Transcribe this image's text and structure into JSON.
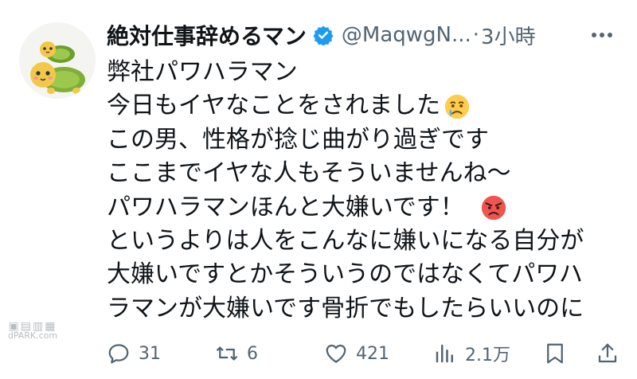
{
  "tweet": {
    "display_name": "絶対仕事辞めるマン",
    "handle": "@MaqwgN...",
    "separator": "·",
    "time": "3小時",
    "lines": [
      "弊社パワハラマン",
      "今日もイヤなことをされました",
      "この男、性格が捻じ曲がり過ぎです",
      "ここまでイヤな人もそういませんね～",
      "パワハラマンほんと大嫌いです！",
      "というよりは人をこんなに嫌いになる自分が",
      "大嫌いですとかそういうのではなくてパワハ",
      "ラマンが大嫌いです骨折でもしたらいいのに"
    ],
    "emojis": [
      "crying-face-emoji",
      "angry-face-emoji"
    ]
  },
  "actions": {
    "reply_count": "31",
    "retweet_count": "6",
    "like_count": "421",
    "view_count": "2.1万"
  },
  "watermark": {
    "line2": "dPARK.com"
  },
  "colors": {
    "text": "#0f1419",
    "secondary": "#536471",
    "verified_blue": "#1d9bf0"
  },
  "icons": [
    "turtle-avatar",
    "verified-badge-icon",
    "more-options-icon",
    "reply-icon",
    "retweet-icon",
    "like-icon",
    "views-icon",
    "bookmark-icon",
    "share-icon"
  ]
}
